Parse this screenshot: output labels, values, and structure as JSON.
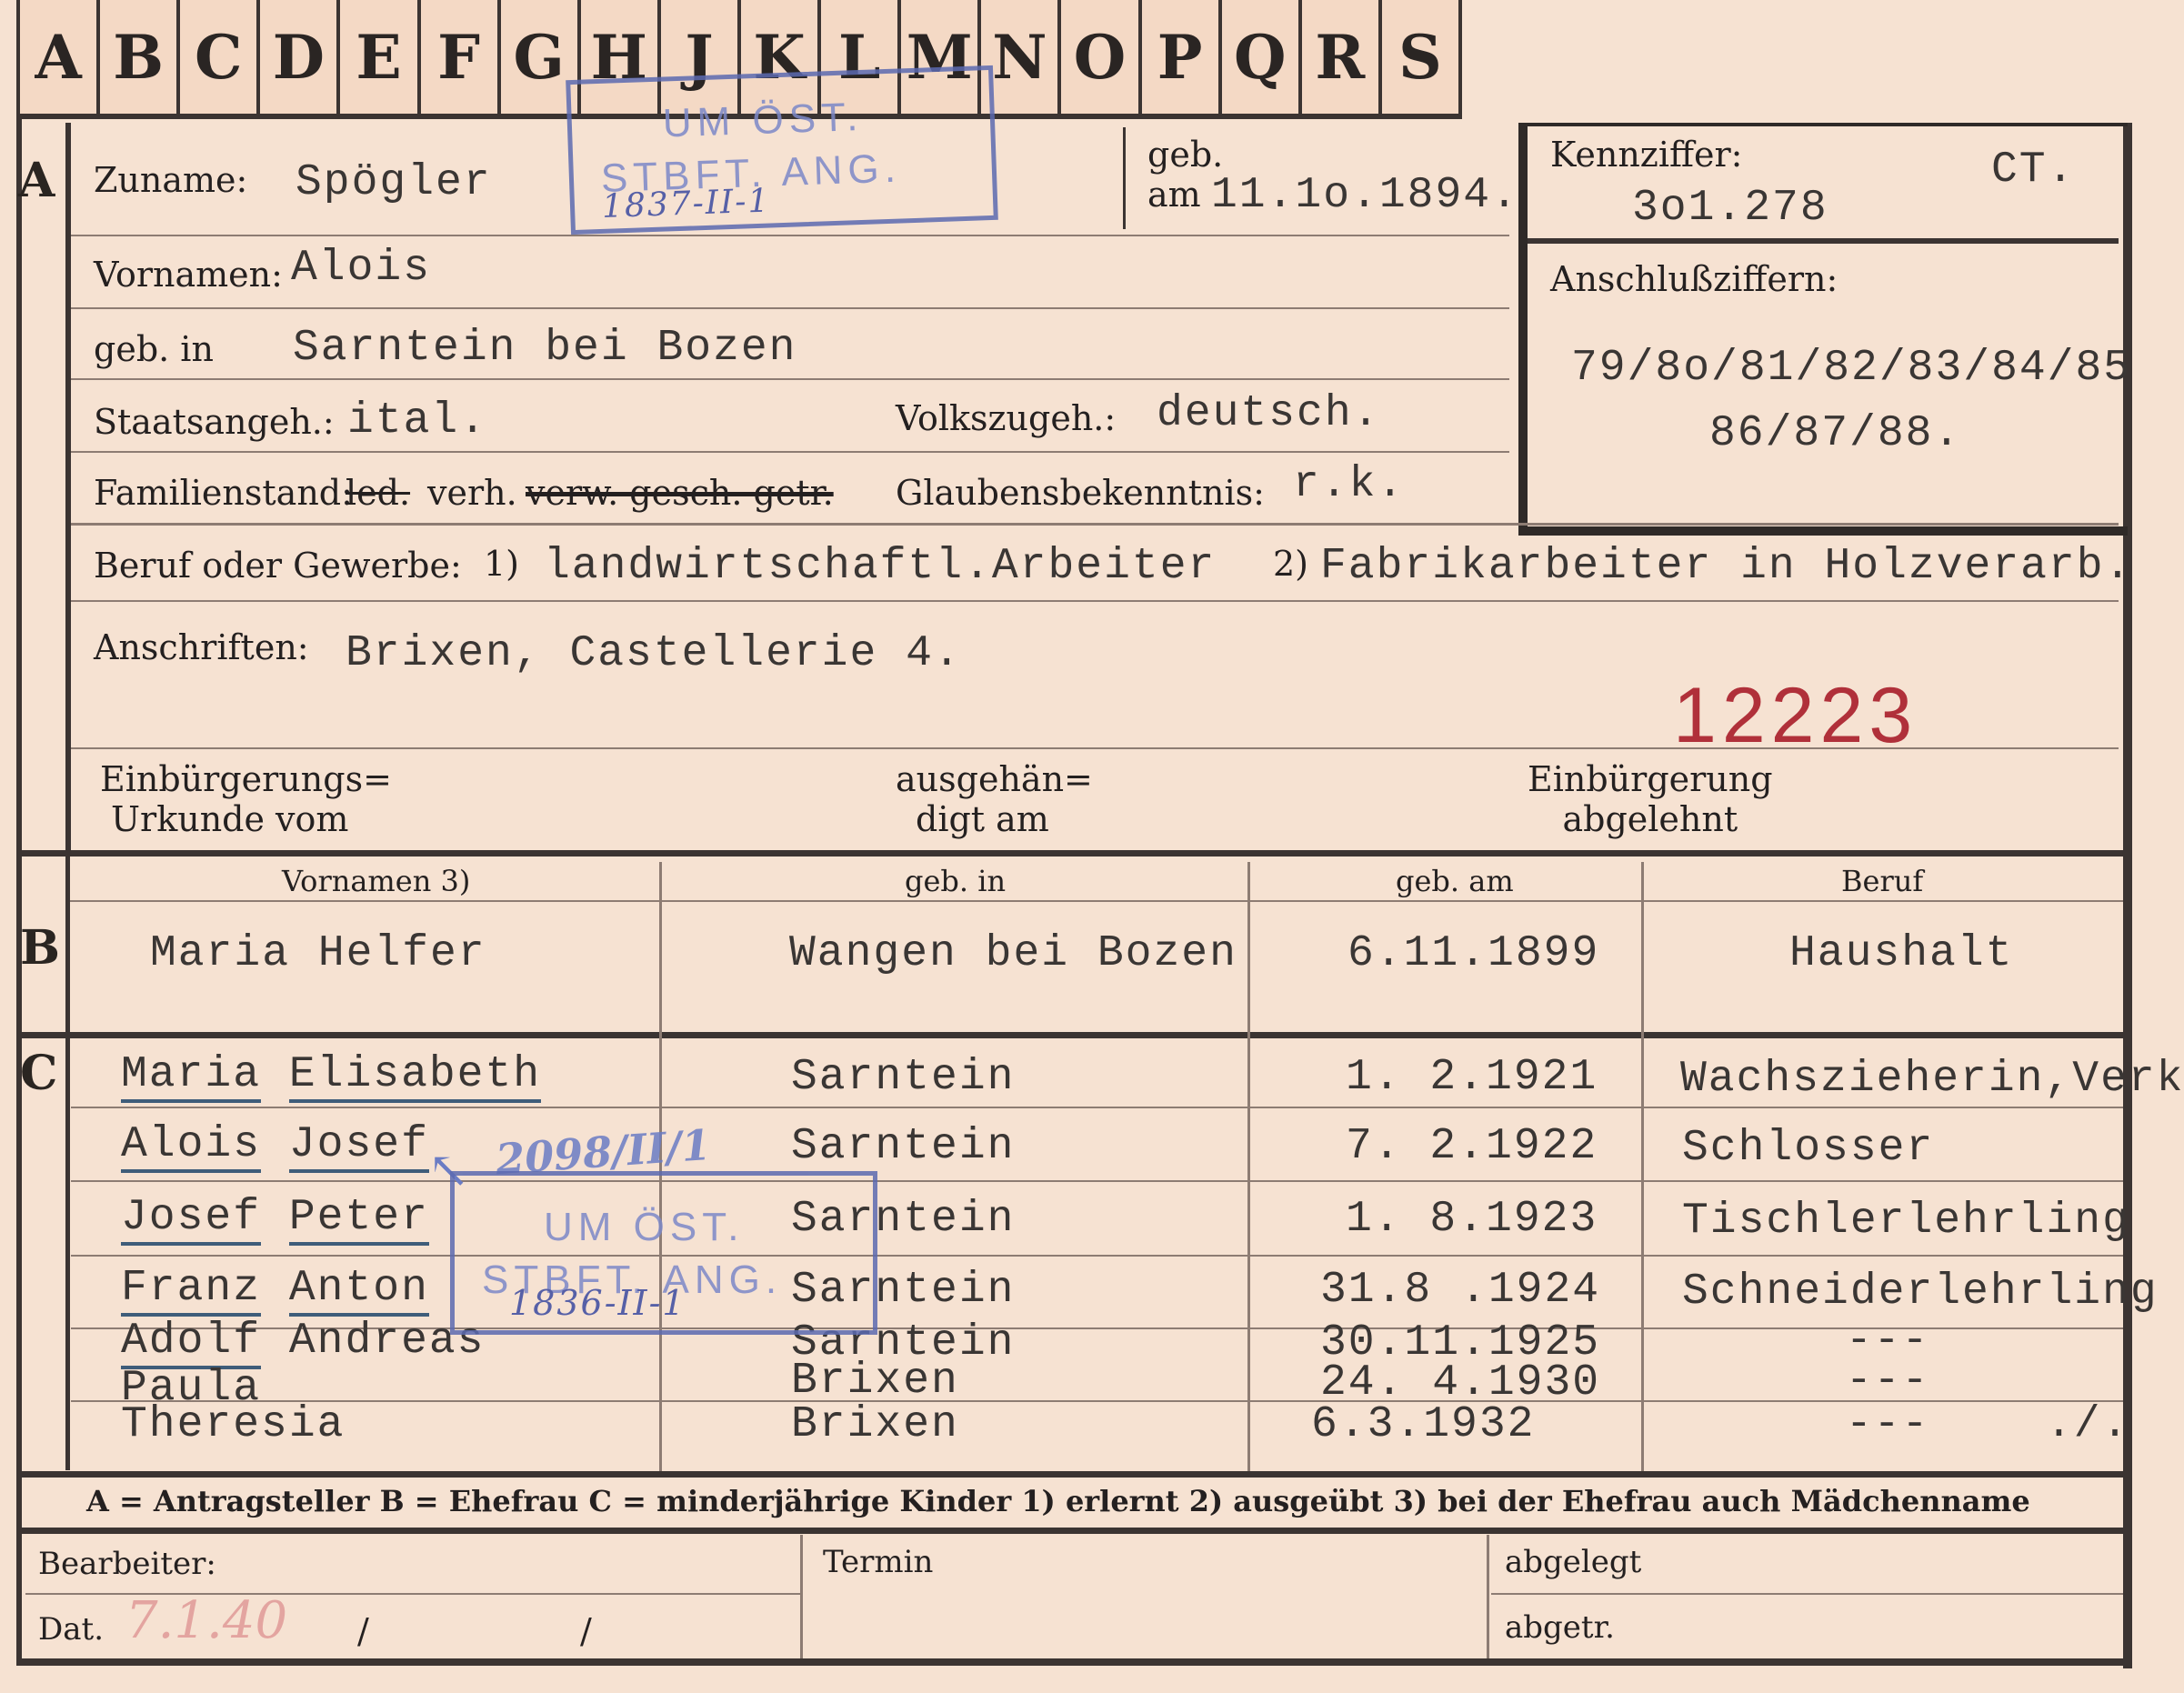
{
  "tabs": [
    "A",
    "B",
    "C",
    "D",
    "E",
    "F",
    "G",
    "H",
    "J",
    "K",
    "L",
    "M",
    "N",
    "O",
    "P",
    "Q",
    "R",
    "S"
  ],
  "section_letters": {
    "a": "A",
    "b": "B",
    "c": "C"
  },
  "applicant": {
    "surname_label": "Zuname:",
    "surname": "Spögler",
    "birth_label_1": "geb.",
    "birth_label_2": "am",
    "birth_date": "11.1o.1894.",
    "first_names_label": "Vornamen:",
    "first_names": "Alois",
    "birthplace_label": "geb. in",
    "birthplace": "Sarntein bei Bozen",
    "citizenship_label": "Staatsangeh.:",
    "citizenship": "ital.",
    "ethnicity_label": "Volkszugeh.:",
    "ethnicity": "deutsch.",
    "marital_label": "Familienstand:",
    "marital_ledig": "led.",
    "marital_value": "verh.",
    "marital_rest": "verw. gesch. getr.",
    "religion_label": "Glaubensbekenntnis:",
    "religion": "r.k.",
    "occupation_label": "Beruf oder Gewerbe:",
    "occ_mark_1": "1)",
    "occupation_1": "landwirtschaftl.Arbeiter",
    "occ_mark_2": "2)",
    "occupation_2": "Fabrikarbeiter in Holzverarb.",
    "address_label": "Anschriften:",
    "address": "Brixen, Castellerie 4.",
    "red_number": "12223",
    "naturalization_doc_label_1": "Einbürgerungs=",
    "naturalization_doc_label_2": "Urkunde vom",
    "handed_label_1": "ausgehän=",
    "handed_label_2": "digt am",
    "rejected_label_1": "Einbürgerung",
    "rejected_label_2": "abgelehnt"
  },
  "reference": {
    "kennziffer_label": "Kennziffer:",
    "ct": "CT.",
    "kennziffer": "3o1.278",
    "anschluss_label": "Anschlußziffern:",
    "anschluss_line_1": "79/8o/81/82/83/84/85",
    "anschluss_line_2": "86/87/88."
  },
  "stamps": [
    {
      "line1": "UM ÖST.",
      "line2": "STBFT. ANG.",
      "handwritten": "1837-II-1"
    },
    {
      "line1": "UM ÖST.",
      "line2": "STBFT. ANG.",
      "handwritten": "1836-II-1"
    }
  ],
  "handwritten_note": "2098/II/1",
  "spouse": {
    "headers": [
      "Vornamen 3)",
      "geb. in",
      "geb. am",
      "Beruf"
    ],
    "first_names": "Maria Helfer",
    "birthplace": "Wangen bei Bozen",
    "birth_date": "6.11.1899",
    "occupation": "Haushalt"
  },
  "children": [
    {
      "first": "Maria",
      "second": "Elisabeth",
      "birthplace": "Sarntein",
      "birth_date": "1. 2.1921",
      "occupation": "Wachszieherin,Verk"
    },
    {
      "first": "Alois",
      "second": "Josef",
      "birthplace": "Sarntein",
      "birth_date": "7. 2.1922",
      "occupation": "Schlosser"
    },
    {
      "first": "Josef",
      "second": "Peter",
      "birthplace": "Sarntein",
      "birth_date": "1. 8.1923",
      "occupation": "Tischlerlehrling"
    },
    {
      "first": "Franz",
      "second": "Anton",
      "birthplace": "Sarntein",
      "birth_date": "31.8 .1924",
      "occupation": "Schneiderlehrling"
    },
    {
      "first": "Adolf",
      "second": "Andreas",
      "birthplace": "Sarntein",
      "birth_date": "30.11.1925",
      "occupation": "---"
    },
    {
      "first": "Paula",
      "second": "",
      "birthplace": "Brixen",
      "birth_date": "24. 4.1930",
      "occupation": "---"
    },
    {
      "first": "Theresia",
      "second": "",
      "birthplace": "Brixen",
      "birth_date": "6.3.1932",
      "occupation": "---"
    }
  ],
  "children_end_mark": "./.",
  "legend": "A = Antragsteller   B = Ehefrau   C = minderjährige Kinder   1) erlernt   2) ausgeübt   3) bei der Ehefrau auch Mädchenname",
  "footer": {
    "clerk_label": "Bearbeiter:",
    "date_label": "Dat.",
    "date_value": "7.1.40",
    "slash_1": "/",
    "slash_2": "/",
    "deadline_label": "Termin",
    "filed_label": "abgelegt",
    "filed_by_label": "abgetr."
  },
  "colors": {
    "paper": "#f6e2d2",
    "ink": "#2a2521",
    "typewriter": "#3a3634",
    "stamp": "#5c6ab0",
    "red_number": "#b0303a"
  }
}
